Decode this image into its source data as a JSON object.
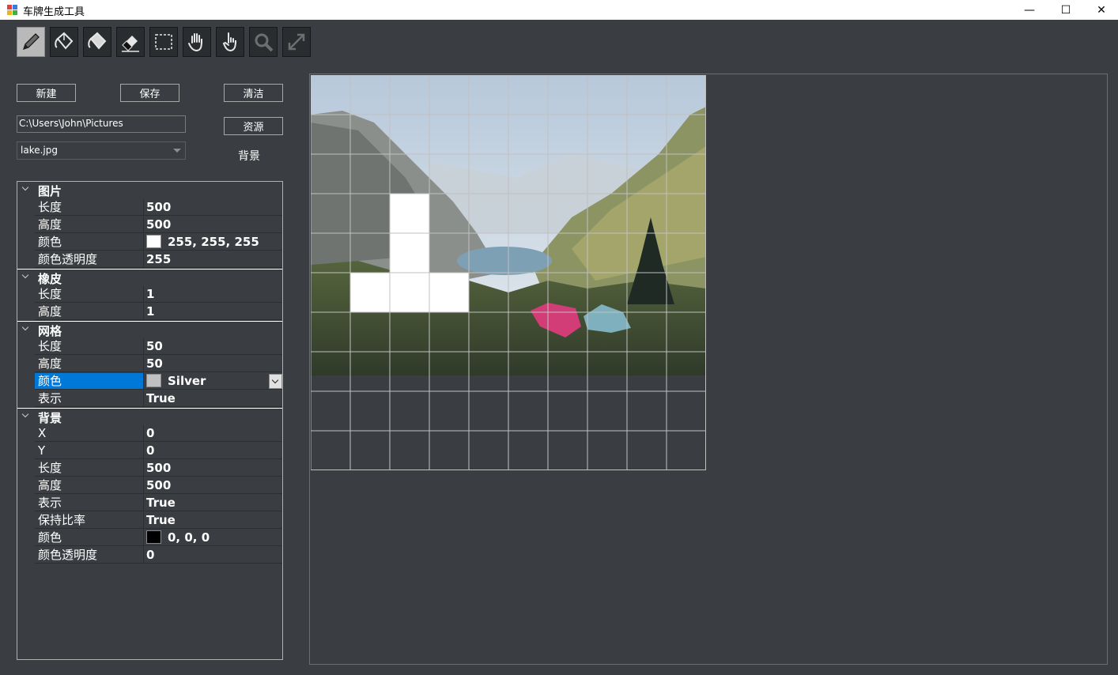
{
  "window": {
    "title": "车牌生成工具",
    "minimize_glyph": "—",
    "maximize_glyph": "☐",
    "close_glyph": "✕"
  },
  "toolbar": {
    "tools": [
      {
        "name": "pencil-tool",
        "icon": "pencil-icon",
        "active": true
      },
      {
        "name": "fill-tool",
        "icon": "paint-bucket-icon"
      },
      {
        "name": "fill-outline-tool",
        "icon": "paint-bucket-outline-icon"
      },
      {
        "name": "eraser-tool",
        "icon": "eraser-icon"
      },
      {
        "name": "select-tool",
        "icon": "selection-rect-icon"
      },
      {
        "name": "pan-tool",
        "icon": "hand-icon"
      },
      {
        "name": "pointer-hand-tool",
        "icon": "pointing-hand-icon"
      },
      {
        "name": "zoom-tool",
        "icon": "magnifier-icon",
        "disabled": true
      },
      {
        "name": "fit-tool",
        "icon": "expand-arrows-icon",
        "disabled": true
      }
    ]
  },
  "actions": {
    "new_label": "新建",
    "save_label": "保存",
    "clear_label": "清洁",
    "resource_label": "资源",
    "background_label": "背景"
  },
  "file": {
    "path": "C:\\Users\\John\\Pictures",
    "selected_file": "lake.jpg"
  },
  "propgrid": {
    "image": {
      "title": "图片",
      "length_label": "长度",
      "length": "500",
      "height_label": "高度",
      "height": "500",
      "color_label": "颜色",
      "color": "255, 255, 255",
      "color_hex": "#ffffff",
      "alpha_label": "颜色透明度",
      "alpha": "255"
    },
    "eraser": {
      "title": "橡皮",
      "length_label": "长度",
      "length": "1",
      "height_label": "高度",
      "height": "1"
    },
    "grid": {
      "title": "网格",
      "length_label": "长度",
      "length": "50",
      "height_label": "高度",
      "height": "50",
      "color_label": "颜色",
      "color": "Silver",
      "color_hex": "#c0c0c0",
      "show_label": "表示",
      "show": "True"
    },
    "background": {
      "title": "背景",
      "x_label": "X",
      "x": "0",
      "y_label": "Y",
      "y": "0",
      "length_label": "长度",
      "length": "500",
      "height_label": "高度",
      "height": "500",
      "show_label": "表示",
      "show": "True",
      "keep_ratio_label": "保持比率",
      "keep_ratio": "True",
      "color_label": "颜色",
      "color": "0, 0, 0",
      "color_hex": "#000000",
      "alpha_label": "颜色透明度",
      "alpha": "0"
    }
  },
  "canvas": {
    "grid_color": "#c0c0c0",
    "cell_size": 50,
    "cols": 10,
    "rows": 10,
    "painted_cells": [
      [
        2,
        3
      ],
      [
        2,
        4
      ],
      [
        1,
        5
      ],
      [
        2,
        5
      ],
      [
        3,
        5
      ]
    ]
  }
}
